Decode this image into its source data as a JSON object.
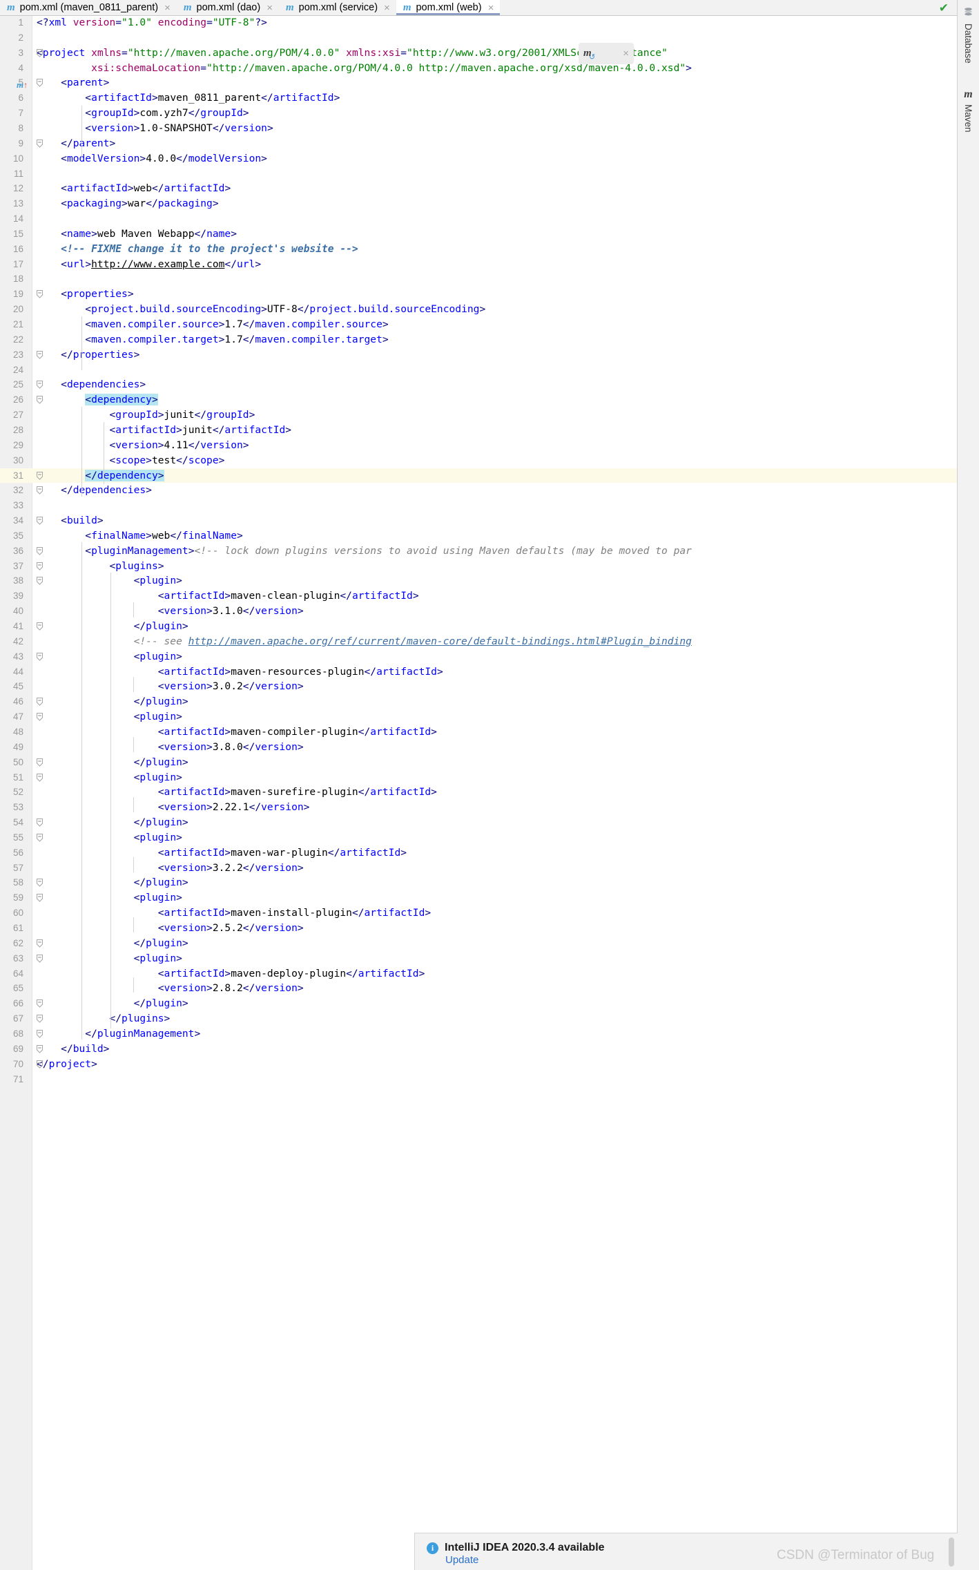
{
  "window": {
    "app": "IntelliJ IDEA",
    "tabs": [
      {
        "icon": "maven-m-icon",
        "label": "pom.xml (maven_0811_parent)",
        "active": false,
        "close": "×"
      },
      {
        "icon": "maven-m-icon",
        "label": "pom.xml (dao)",
        "active": false,
        "close": "×"
      },
      {
        "icon": "maven-m-icon",
        "label": "pom.xml (service)",
        "active": false,
        "close": "×"
      },
      {
        "icon": "maven-m-icon",
        "label": "pom.xml (web)",
        "active": true,
        "close": "×"
      }
    ]
  },
  "editor": {
    "inspection_status": "✔",
    "file": "pom.xml",
    "lines": [
      {
        "n": 1,
        "html": "<span class=\"tag\">&lt;?</span><span class=\"tagname\">xml</span> <span class=\"attr\">version</span><span class=\"tag\">=</span><span class=\"str\">\"1.0\"</span> <span class=\"attr\">encoding</span><span class=\"tag\">=</span><span class=\"str\">\"UTF-8\"</span><span class=\"tag\">?&gt;</span>"
      },
      {
        "n": 2,
        "html": ""
      },
      {
        "n": 3,
        "html": "<span class=\"tag\">&lt;</span><span class=\"tagname\">project</span> <span class=\"attr\">xmlns</span><span class=\"tag\">=</span><span class=\"str\">\"http://maven.apache.org/POM/4.0.0\"</span> <span class=\"attr\">xmlns:xsi</span><span class=\"tag\">=</span><span class=\"str\">\"http://www.w3.org/2001/XMLSchema-instance\"</span>"
      },
      {
        "n": 4,
        "html": "         <span class=\"attr\">xsi:schemaLocation</span><span class=\"tag\">=</span><span class=\"str\">\"http://maven.apache.org/POM/4.0.0 http://maven.apache.org/xsd/maven-4.0.0.xsd\"</span><span class=\"tag\">&gt;</span>"
      },
      {
        "n": 5,
        "html": "    <span class=\"tag\">&lt;</span><span class=\"tagname\">parent</span><span class=\"tag\">&gt;</span>"
      },
      {
        "n": 6,
        "html": "        <span class=\"tag\">&lt;</span><span class=\"tagname\">artifactId</span><span class=\"tag\">&gt;</span><span class=\"txtv\">maven_0811_parent</span><span class=\"tag\">&lt;/</span><span class=\"tagname\">artifactId</span><span class=\"tag\">&gt;</span>"
      },
      {
        "n": 7,
        "html": "        <span class=\"tag\">&lt;</span><span class=\"tagname\">groupId</span><span class=\"tag\">&gt;</span><span class=\"txtv\">com.yzh7</span><span class=\"tag\">&lt;/</span><span class=\"tagname\">groupId</span><span class=\"tag\">&gt;</span>"
      },
      {
        "n": 8,
        "html": "        <span class=\"tag\">&lt;</span><span class=\"tagname\">version</span><span class=\"tag\">&gt;</span><span class=\"txtv\">1.0-SNAPSHOT</span><span class=\"tag\">&lt;/</span><span class=\"tagname\">version</span><span class=\"tag\">&gt;</span>"
      },
      {
        "n": 9,
        "html": "    <span class=\"tag\">&lt;/</span><span class=\"tagname\">parent</span><span class=\"tag\">&gt;</span>"
      },
      {
        "n": 10,
        "html": "    <span class=\"tag\">&lt;</span><span class=\"tagname\">modelVersion</span><span class=\"tag\">&gt;</span><span class=\"txtv\">4.0.0</span><span class=\"tag\">&lt;/</span><span class=\"tagname\">modelVersion</span><span class=\"tag\">&gt;</span>"
      },
      {
        "n": 11,
        "html": ""
      },
      {
        "n": 12,
        "html": "    <span class=\"tag\">&lt;</span><span class=\"tagname\">artifactId</span><span class=\"tag\">&gt;</span><span class=\"txtv\">web</span><span class=\"tag\">&lt;/</span><span class=\"tagname\">artifactId</span><span class=\"tag\">&gt;</span>"
      },
      {
        "n": 13,
        "html": "    <span class=\"tag\">&lt;</span><span class=\"tagname\">packaging</span><span class=\"tag\">&gt;</span><span class=\"txtv\">war</span><span class=\"tag\">&lt;/</span><span class=\"tagname\">packaging</span><span class=\"tag\">&gt;</span>"
      },
      {
        "n": 14,
        "html": ""
      },
      {
        "n": 15,
        "html": "    <span class=\"tag\">&lt;</span><span class=\"tagname\">name</span><span class=\"tag\">&gt;</span><span class=\"txtv\">web Maven Webapp</span><span class=\"tag\">&lt;/</span><span class=\"tagname\">name</span><span class=\"tag\">&gt;</span>"
      },
      {
        "n": 16,
        "html": "    <span class=\"cmtb\">&lt;!-- FIXME change it to the project's website --&gt;</span>"
      },
      {
        "n": 17,
        "html": "    <span class=\"tag\">&lt;</span><span class=\"tagname\">url</span><span class=\"tag\">&gt;</span><span class=\"lnk\">http://www.example.com</span><span class=\"tag\">&lt;/</span><span class=\"tagname\">url</span><span class=\"tag\">&gt;</span>"
      },
      {
        "n": 18,
        "html": ""
      },
      {
        "n": 19,
        "html": "    <span class=\"tag\">&lt;</span><span class=\"tagname\">properties</span><span class=\"tag\">&gt;</span>"
      },
      {
        "n": 20,
        "html": "        <span class=\"tag\">&lt;</span><span class=\"tagname\">project.build.sourceEncoding</span><span class=\"tag\">&gt;</span><span class=\"txtv\">UTF-8</span><span class=\"tag\">&lt;/</span><span class=\"tagname\">project.build.sourceEncoding</span><span class=\"tag\">&gt;</span>"
      },
      {
        "n": 21,
        "html": "        <span class=\"tag\">&lt;</span><span class=\"tagname\">maven.compiler.source</span><span class=\"tag\">&gt;</span><span class=\"txtv\">1.7</span><span class=\"tag\">&lt;/</span><span class=\"tagname\">maven.compiler.source</span><span class=\"tag\">&gt;</span>"
      },
      {
        "n": 22,
        "html": "        <span class=\"tag\">&lt;</span><span class=\"tagname\">maven.compiler.target</span><span class=\"tag\">&gt;</span><span class=\"txtv\">1.7</span><span class=\"tag\">&lt;/</span><span class=\"tagname\">maven.compiler.target</span><span class=\"tag\">&gt;</span>"
      },
      {
        "n": 23,
        "html": "    <span class=\"tag\">&lt;/</span><span class=\"tagname\">properties</span><span class=\"tag\">&gt;</span>"
      },
      {
        "n": 24,
        "html": ""
      },
      {
        "n": 25,
        "html": "    <span class=\"tag\">&lt;</span><span class=\"tagname\">dependencies</span><span class=\"tag\">&gt;</span>"
      },
      {
        "n": 26,
        "html": "        <span class=\"selbg\"><span class=\"tag\">&lt;</span><span class=\"tagname\">dependency</span><span class=\"tag\">&gt;</span></span>"
      },
      {
        "n": 27,
        "html": "            <span class=\"tag\">&lt;</span><span class=\"tagname\">groupId</span><span class=\"tag\">&gt;</span><span class=\"txtv\">junit</span><span class=\"tag\">&lt;/</span><span class=\"tagname\">groupId</span><span class=\"tag\">&gt;</span>"
      },
      {
        "n": 28,
        "html": "            <span class=\"tag\">&lt;</span><span class=\"tagname\">artifactId</span><span class=\"tag\">&gt;</span><span class=\"txtv\">junit</span><span class=\"tag\">&lt;/</span><span class=\"tagname\">artifactId</span><span class=\"tag\">&gt;</span>"
      },
      {
        "n": 29,
        "html": "            <span class=\"tag\">&lt;</span><span class=\"tagname\">version</span><span class=\"tag\">&gt;</span><span class=\"txtv\">4.11</span><span class=\"tag\">&lt;/</span><span class=\"tagname\">version</span><span class=\"tag\">&gt;</span>"
      },
      {
        "n": 30,
        "html": "            <span class=\"tag\">&lt;</span><span class=\"tagname\">scope</span><span class=\"tag\">&gt;</span><span class=\"txtv\">test</span><span class=\"tag\">&lt;/</span><span class=\"tagname\">scope</span><span class=\"tag\">&gt;</span>"
      },
      {
        "n": 31,
        "html": "        <span class=\"selbg\"><span class=\"tag\">&lt;/</span><span class=\"tagname\">dependency</span><span class=\"tag\">&gt;</span></span>",
        "highlight": true
      },
      {
        "n": 32,
        "html": "    <span class=\"tag\">&lt;/</span><span class=\"tagname\">dependencies</span><span class=\"tag\">&gt;</span>"
      },
      {
        "n": 33,
        "html": ""
      },
      {
        "n": 34,
        "html": "    <span class=\"tag\">&lt;</span><span class=\"tagname\">build</span><span class=\"tag\">&gt;</span>"
      },
      {
        "n": 35,
        "html": "        <span class=\"tag\">&lt;</span><span class=\"tagname\">finalName</span><span class=\"tag\">&gt;</span><span class=\"txtv\">web</span><span class=\"tag\">&lt;/</span><span class=\"tagname\">finalName</span><span class=\"tag\">&gt;</span>"
      },
      {
        "n": 36,
        "html": "        <span class=\"tag\">&lt;</span><span class=\"tagname\">pluginManagement</span><span class=\"tag\">&gt;</span><span class=\"cmt\">&lt;!-- lock down plugins versions to avoid using Maven defaults (may be moved to par</span>"
      },
      {
        "n": 37,
        "html": "            <span class=\"tag\">&lt;</span><span class=\"tagname\">plugins</span><span class=\"tag\">&gt;</span>"
      },
      {
        "n": 38,
        "html": "                <span class=\"tag\">&lt;</span><span class=\"tagname\">plugin</span><span class=\"tag\">&gt;</span>"
      },
      {
        "n": 39,
        "html": "                    <span class=\"tag\">&lt;</span><span class=\"tagname\">artifactId</span><span class=\"tag\">&gt;</span><span class=\"txtv\">maven-clean-plugin</span><span class=\"tag\">&lt;/</span><span class=\"tagname\">artifactId</span><span class=\"tag\">&gt;</span>"
      },
      {
        "n": 40,
        "html": "                    <span class=\"tag\">&lt;</span><span class=\"tagname\">version</span><span class=\"tag\">&gt;</span><span class=\"txtv\">3.1.0</span><span class=\"tag\">&lt;/</span><span class=\"tagname\">version</span><span class=\"tag\">&gt;</span>"
      },
      {
        "n": 41,
        "html": "                <span class=\"tag\">&lt;/</span><span class=\"tagname\">plugin</span><span class=\"tag\">&gt;</span>"
      },
      {
        "n": 42,
        "html": "                <span class=\"cmt\">&lt;!-- see </span><span class=\"lnkb\">http://maven.apache.org/ref/current/maven-core/default-bindings.html#Plugin_binding</span>"
      },
      {
        "n": 43,
        "html": "                <span class=\"tag\">&lt;</span><span class=\"tagname\">plugin</span><span class=\"tag\">&gt;</span>"
      },
      {
        "n": 44,
        "html": "                    <span class=\"tag\">&lt;</span><span class=\"tagname\">artifactId</span><span class=\"tag\">&gt;</span><span class=\"txtv\">maven-resources-plugin</span><span class=\"tag\">&lt;/</span><span class=\"tagname\">artifactId</span><span class=\"tag\">&gt;</span>"
      },
      {
        "n": 45,
        "html": "                    <span class=\"tag\">&lt;</span><span class=\"tagname\">version</span><span class=\"tag\">&gt;</span><span class=\"txtv\">3.0.2</span><span class=\"tag\">&lt;/</span><span class=\"tagname\">version</span><span class=\"tag\">&gt;</span>"
      },
      {
        "n": 46,
        "html": "                <span class=\"tag\">&lt;/</span><span class=\"tagname\">plugin</span><span class=\"tag\">&gt;</span>"
      },
      {
        "n": 47,
        "html": "                <span class=\"tag\">&lt;</span><span class=\"tagname\">plugin</span><span class=\"tag\">&gt;</span>"
      },
      {
        "n": 48,
        "html": "                    <span class=\"tag\">&lt;</span><span class=\"tagname\">artifactId</span><span class=\"tag\">&gt;</span><span class=\"txtv\">maven-compiler-plugin</span><span class=\"tag\">&lt;/</span><span class=\"tagname\">artifactId</span><span class=\"tag\">&gt;</span>"
      },
      {
        "n": 49,
        "html": "                    <span class=\"tag\">&lt;</span><span class=\"tagname\">version</span><span class=\"tag\">&gt;</span><span class=\"txtv\">3.8.0</span><span class=\"tag\">&lt;/</span><span class=\"tagname\">version</span><span class=\"tag\">&gt;</span>"
      },
      {
        "n": 50,
        "html": "                <span class=\"tag\">&lt;/</span><span class=\"tagname\">plugin</span><span class=\"tag\">&gt;</span>"
      },
      {
        "n": 51,
        "html": "                <span class=\"tag\">&lt;</span><span class=\"tagname\">plugin</span><span class=\"tag\">&gt;</span>"
      },
      {
        "n": 52,
        "html": "                    <span class=\"tag\">&lt;</span><span class=\"tagname\">artifactId</span><span class=\"tag\">&gt;</span><span class=\"txtv\">maven-surefire-plugin</span><span class=\"tag\">&lt;/</span><span class=\"tagname\">artifactId</span><span class=\"tag\">&gt;</span>"
      },
      {
        "n": 53,
        "html": "                    <span class=\"tag\">&lt;</span><span class=\"tagname\">version</span><span class=\"tag\">&gt;</span><span class=\"txtv\">2.22.1</span><span class=\"tag\">&lt;/</span><span class=\"tagname\">version</span><span class=\"tag\">&gt;</span>"
      },
      {
        "n": 54,
        "html": "                <span class=\"tag\">&lt;/</span><span class=\"tagname\">plugin</span><span class=\"tag\">&gt;</span>"
      },
      {
        "n": 55,
        "html": "                <span class=\"tag\">&lt;</span><span class=\"tagname\">plugin</span><span class=\"tag\">&gt;</span>"
      },
      {
        "n": 56,
        "html": "                    <span class=\"tag\">&lt;</span><span class=\"tagname\">artifactId</span><span class=\"tag\">&gt;</span><span class=\"txtv\">maven-war-plugin</span><span class=\"tag\">&lt;/</span><span class=\"tagname\">artifactId</span><span class=\"tag\">&gt;</span>"
      },
      {
        "n": 57,
        "html": "                    <span class=\"tag\">&lt;</span><span class=\"tagname\">version</span><span class=\"tag\">&gt;</span><span class=\"txtv\">3.2.2</span><span class=\"tag\">&lt;/</span><span class=\"tagname\">version</span><span class=\"tag\">&gt;</span>"
      },
      {
        "n": 58,
        "html": "                <span class=\"tag\">&lt;/</span><span class=\"tagname\">plugin</span><span class=\"tag\">&gt;</span>"
      },
      {
        "n": 59,
        "html": "                <span class=\"tag\">&lt;</span><span class=\"tagname\">plugin</span><span class=\"tag\">&gt;</span>"
      },
      {
        "n": 60,
        "html": "                    <span class=\"tag\">&lt;</span><span class=\"tagname\">artifactId</span><span class=\"tag\">&gt;</span><span class=\"txtv\">maven-install-plugin</span><span class=\"tag\">&lt;/</span><span class=\"tagname\">artifactId</span><span class=\"tag\">&gt;</span>"
      },
      {
        "n": 61,
        "html": "                    <span class=\"tag\">&lt;</span><span class=\"tagname\">version</span><span class=\"tag\">&gt;</span><span class=\"txtv\">2.5.2</span><span class=\"tag\">&lt;/</span><span class=\"tagname\">version</span><span class=\"tag\">&gt;</span>"
      },
      {
        "n": 62,
        "html": "                <span class=\"tag\">&lt;/</span><span class=\"tagname\">plugin</span><span class=\"tag\">&gt;</span>"
      },
      {
        "n": 63,
        "html": "                <span class=\"tag\">&lt;</span><span class=\"tagname\">plugin</span><span class=\"tag\">&gt;</span>"
      },
      {
        "n": 64,
        "html": "                    <span class=\"tag\">&lt;</span><span class=\"tagname\">artifactId</span><span class=\"tag\">&gt;</span><span class=\"txtv\">maven-deploy-plugin</span><span class=\"tag\">&lt;/</span><span class=\"tagname\">artifactId</span><span class=\"tag\">&gt;</span>"
      },
      {
        "n": 65,
        "html": "                    <span class=\"tag\">&lt;</span><span class=\"tagname\">version</span><span class=\"tag\">&gt;</span><span class=\"txtv\">2.8.2</span><span class=\"tag\">&lt;/</span><span class=\"tagname\">version</span><span class=\"tag\">&gt;</span>"
      },
      {
        "n": 66,
        "html": "                <span class=\"tag\">&lt;/</span><span class=\"tagname\">plugin</span><span class=\"tag\">&gt;</span>"
      },
      {
        "n": 67,
        "html": "            <span class=\"tag\">&lt;/</span><span class=\"tagname\">plugins</span><span class=\"tag\">&gt;</span>"
      },
      {
        "n": 68,
        "html": "        <span class=\"tag\">&lt;/</span><span class=\"tagname\">pluginManagement</span><span class=\"tag\">&gt;</span>"
      },
      {
        "n": 69,
        "html": "    <span class=\"tag\">&lt;/</span><span class=\"tagname\">build</span><span class=\"tag\">&gt;</span>"
      },
      {
        "n": 70,
        "html": "<span class=\"tag\">&lt;/</span><span class=\"tagname\">project</span><span class=\"tag\">&gt;</span>"
      },
      {
        "n": 71,
        "html": ""
      }
    ],
    "gutter_maven_line": 5,
    "fold_lines": [
      3,
      5,
      9,
      19,
      23,
      25,
      26,
      31,
      32,
      34,
      36,
      37,
      38,
      41,
      43,
      46,
      47,
      50,
      51,
      54,
      55,
      58,
      59,
      62,
      63,
      66,
      67,
      68,
      69,
      70
    ]
  },
  "maven_popup": {
    "icon": "maven-reload-icon",
    "close": "×"
  },
  "tool_stripe": {
    "items": [
      {
        "icon": "database-icon",
        "label": "Database"
      },
      {
        "icon": "maven-m-icon",
        "label": "Maven"
      }
    ]
  },
  "notification": {
    "icon": "info-icon",
    "icon_glyph": "i",
    "title": "IntelliJ IDEA 2020.3.4 available",
    "action": "Update"
  },
  "watermark": "CSDN @Terminator of Bug",
  "colors": {
    "tag": "#000080",
    "tagname": "#0000ff",
    "attr": "#9e0066",
    "string": "#008000",
    "comment": "#808080",
    "selection": "#b4e5f0",
    "caret_line": "#fdfbe8",
    "accent": "#46a0d8",
    "ok": "#2e9e3e",
    "link": "#2a6fc9"
  }
}
